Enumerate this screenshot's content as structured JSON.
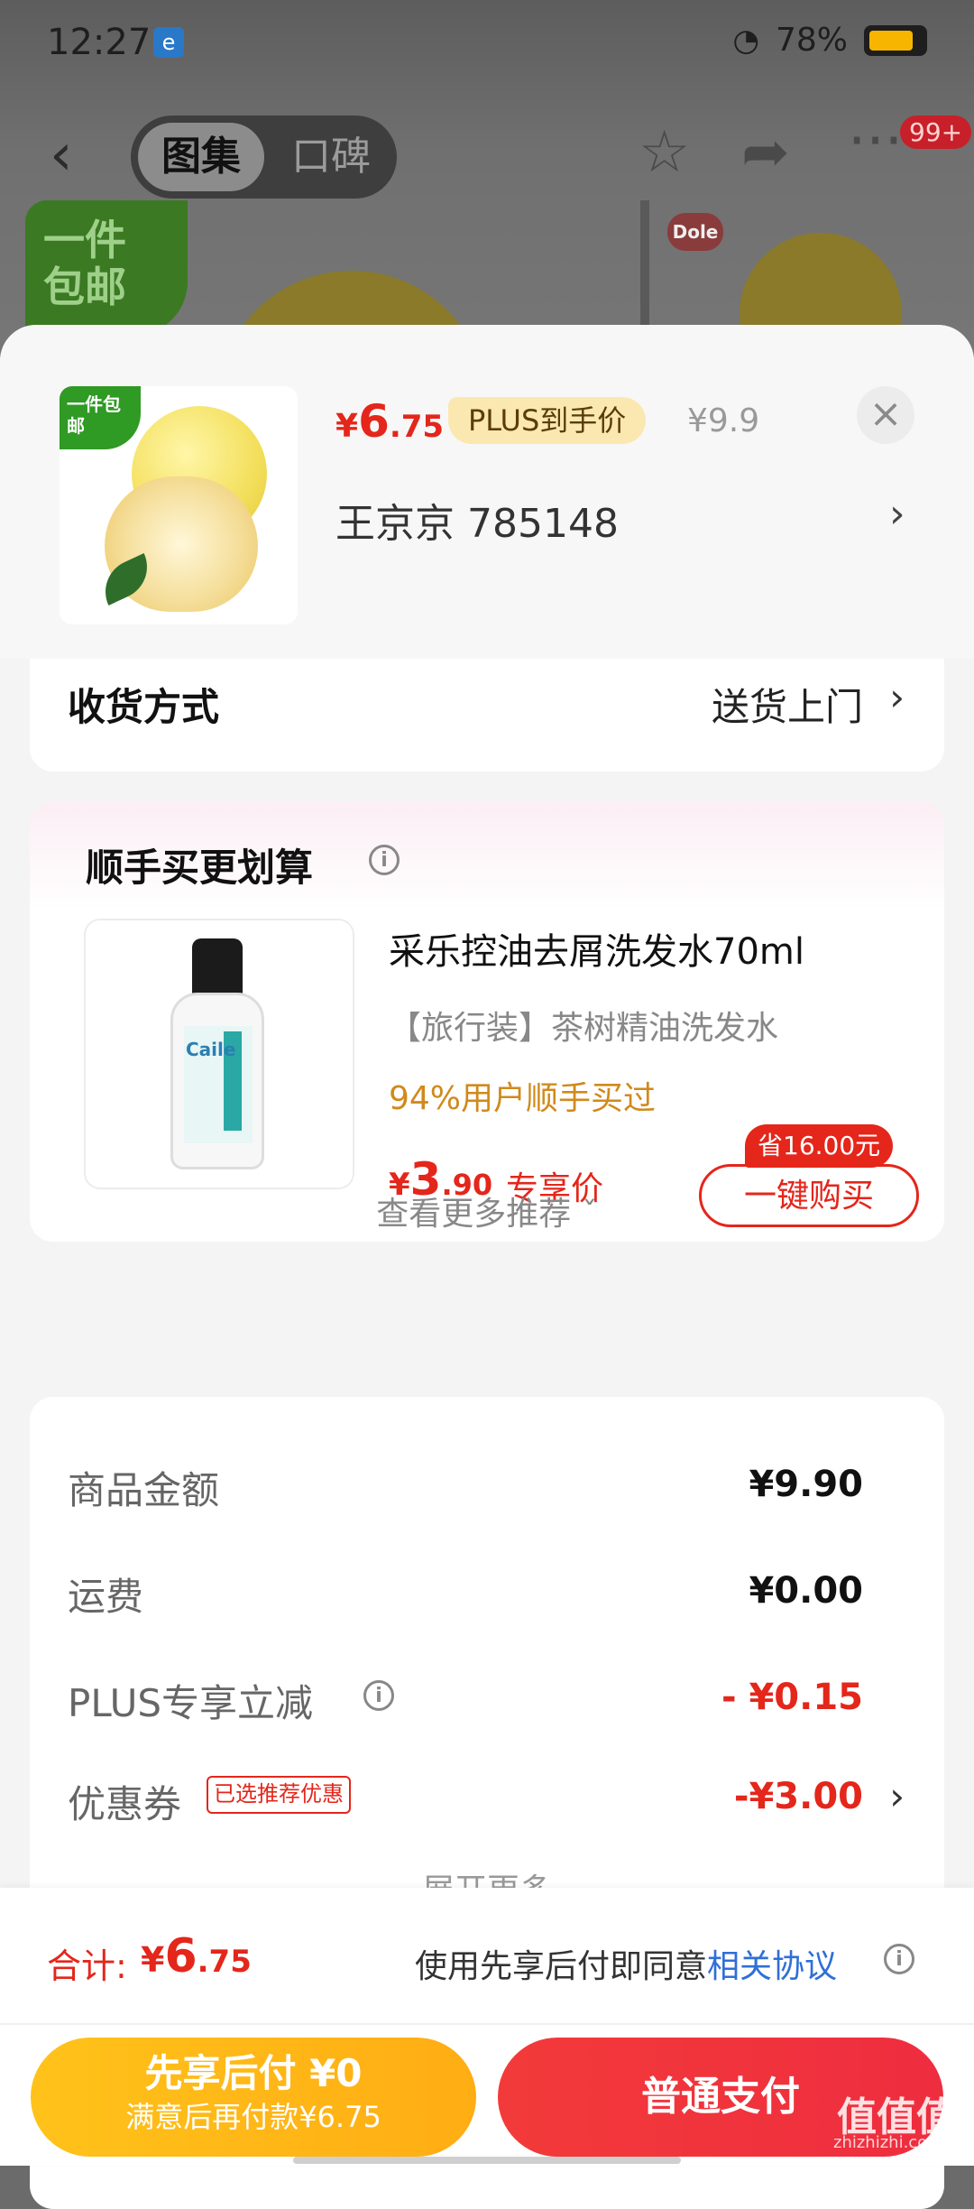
{
  "status_bar": {
    "time": "12:27",
    "app_icon": "e",
    "battery": "78%",
    "signal_icon": "wifi-icon"
  },
  "product_nav": {
    "tabs": [
      "图集",
      "口碑"
    ],
    "active_tab": "图集",
    "cart_badge": "99+",
    "icons": [
      "back-icon",
      "star-icon",
      "share-icon",
      "more-icon"
    ]
  },
  "background": {
    "tag_line1": "一件",
    "tag_line2": "包邮",
    "brand_logo": "Dole"
  },
  "sheet": {
    "thumb_tag": "一件包邮",
    "price": {
      "yen": "¥",
      "int": "6",
      "dec": ".75"
    },
    "price_label": "PLUS到手价",
    "original_price": "¥9.9",
    "close": "×",
    "address": "王京京   785148",
    "address_arrow": "›"
  },
  "delivery": {
    "label": "收货方式",
    "value": "送货上门",
    "arrow": "›"
  },
  "recommend": {
    "title": "顺手买更划算",
    "product_brand": "Caile",
    "product_name": "采乐控油去屑洗发水70ml",
    "product_sub": "【旅行装】茶树精油洗发水",
    "stat": "94%用户顺手买过",
    "price": {
      "yen": "¥",
      "int": "3",
      "dec": ".90"
    },
    "price_label": "专享价",
    "save_badge": "省16.00元",
    "buy_label": "一键购买",
    "more": "查看更多推荐 ˇ"
  },
  "summary": {
    "rows": [
      {
        "label": "商品金额",
        "value": "¥9.90"
      },
      {
        "label": "运费",
        "value": "¥0.00"
      },
      {
        "label": "PLUS专享立减",
        "value": "- ¥0.15"
      },
      {
        "label": "优惠券",
        "value": "-¥3.00"
      }
    ],
    "coupon_tag": "已选推荐优惠",
    "expand": "展开更多"
  },
  "bottom": {
    "total_label": "合计:",
    "total": {
      "yen": "¥",
      "int": "6",
      "dec": ".75"
    },
    "agree_prefix": "使用先享后付即同意",
    "agree_link": "相关协议",
    "bnpl_main": "先享后付 ¥0",
    "bnpl_sub": "满意后再付款¥6.75",
    "pay_label": "普通支付"
  },
  "watermark": {
    "main": "值值值",
    "sub": "zhizhizhi.com"
  },
  "colors": {
    "accent_red": "#e4261b",
    "bnpl_yellow": "#ffc21a",
    "link_blue": "#2f6fd6",
    "stat_orange": "#d08a1c"
  }
}
